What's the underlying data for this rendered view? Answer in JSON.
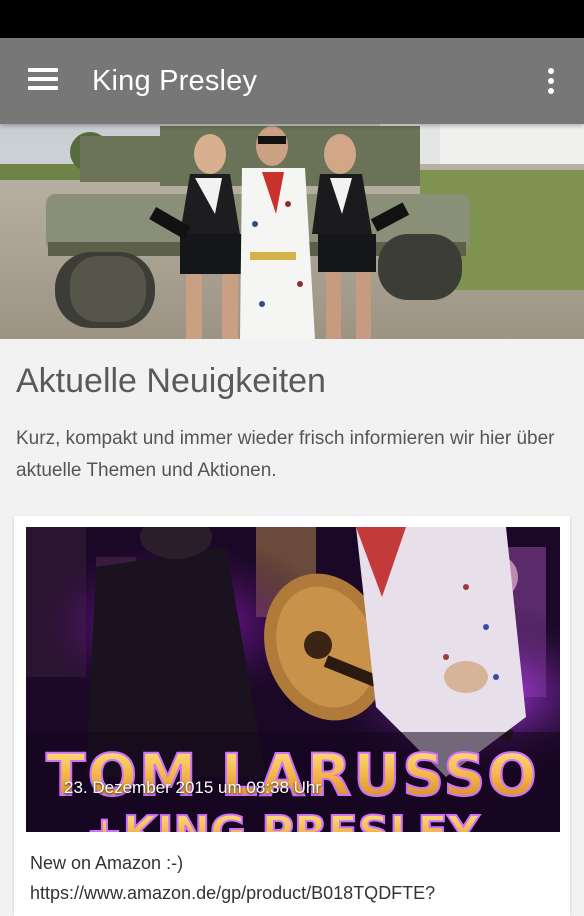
{
  "app": {
    "title": "King Presley",
    "accent_color": "#777777",
    "menu_icon": "hamburger-menu-icon",
    "overflow_icon": "more-vert-icon"
  },
  "main": {
    "section_title": "Aktuelle Neuigkeiten",
    "section_description": "Kurz, kompakt und immer wieder frisch informieren wir hier über aktuelle Themen und Aktionen."
  },
  "news": [
    {
      "date": "23. Dezember 2015 um 08:38 Uhr",
      "image_text_line1": "TOM LARUSSO",
      "image_text_line2": "+KING PRESLEY",
      "text_line1": "New on Amazon :-)",
      "text_line2": "https://www.amazon.de/gp/product/B018TQDFTE?"
    }
  ]
}
